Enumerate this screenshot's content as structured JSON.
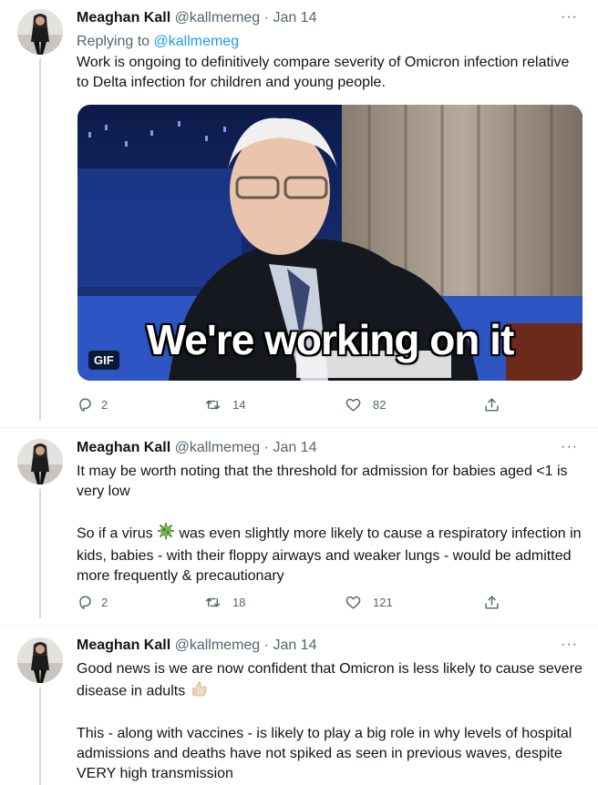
{
  "tweets": [
    {
      "author_name": "Meaghan Kall",
      "handle": "@kallmemeg",
      "separator": "·",
      "date": "Jan 14",
      "more": "···",
      "replying_to_prefix": "Replying to ",
      "replying_to_handle": "@kallmemeg",
      "text": [
        "Work is ongoing to definitively compare severity of Omicron infection relative to Delta infection for children and young people."
      ],
      "media": {
        "badge": "GIF",
        "caption": "We're working on it"
      },
      "replies": "2",
      "retweets": "14",
      "likes": "82"
    },
    {
      "author_name": "Meaghan Kall",
      "handle": "@kallmemeg",
      "separator": "·",
      "date": "Jan 14",
      "more": "···",
      "text_p1": "It may be worth noting that the threshold for admission for babies aged <1 is very low",
      "text_p2_before": "So if a virus ",
      "text_p2_after": " was even slightly more likely to cause a respiratory infection in kids, babies - with their floppy airways and weaker lungs - would be admitted more frequently & precautionary",
      "replies": "2",
      "retweets": "18",
      "likes": "121"
    },
    {
      "author_name": "Meaghan Kall",
      "handle": "@kallmemeg",
      "separator": "·",
      "date": "Jan 14",
      "more": "···",
      "text_p1_before": "Good news is we are now confident that Omicron is less likely to cause severe disease in adults ",
      "text_p2": "This - along with vaccines - is likely to play a big role in why levels of hospital admissions and deaths have not spiked as seen in previous waves, despite VERY high transmission"
    }
  ],
  "colors": {
    "text": "#0f1419",
    "secondary": "#536471",
    "link": "#1d9bf0",
    "thread_line": "#cfd9de"
  },
  "icons": [
    "reply-icon",
    "retweet-icon",
    "like-icon",
    "share-icon",
    "more-icon",
    "virus-emoji",
    "thumbs-up-emoji"
  ]
}
